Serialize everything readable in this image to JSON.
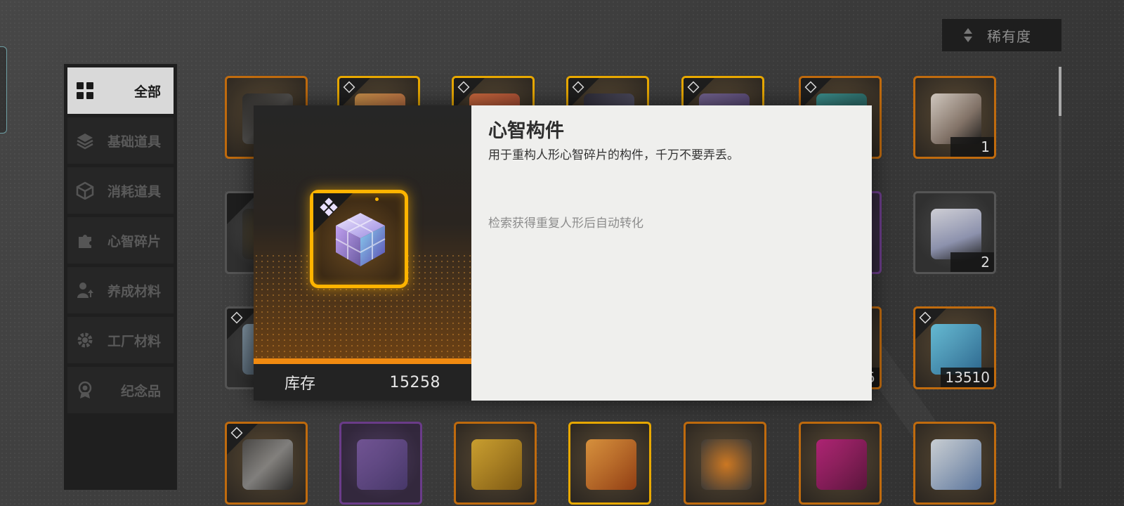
{
  "sort": {
    "label": "稀有度",
    "icon": "sort-icon"
  },
  "sidebar": {
    "items": [
      {
        "label": "全部",
        "icon": "grid-icon",
        "active": true
      },
      {
        "label": "基础道具",
        "icon": "layers-icon",
        "active": false
      },
      {
        "label": "消耗道具",
        "icon": "box-icon",
        "active": false
      },
      {
        "label": "心智碎片",
        "icon": "puzzle-icon",
        "active": false
      },
      {
        "label": "养成材料",
        "icon": "person-up-icon",
        "active": false
      },
      {
        "label": "工厂材料",
        "icon": "gear-icon",
        "active": false
      },
      {
        "label": "纪念品",
        "icon": "medal-icon",
        "active": false
      }
    ]
  },
  "grid": {
    "tiles": [
      {
        "rarity": "orange",
        "count": ""
      },
      {
        "rarity": "gold",
        "count": ""
      },
      {
        "rarity": "gold",
        "count": ""
      },
      {
        "rarity": "gold",
        "count": ""
      },
      {
        "rarity": "gold",
        "count": ""
      },
      {
        "rarity": "orange",
        "count": ""
      },
      {
        "rarity": "orange",
        "count": "1"
      },
      {
        "rarity": "grey",
        "count": ""
      },
      {
        "rarity": "purple",
        "count": ""
      },
      {
        "rarity": "grey",
        "count": "2"
      },
      {
        "rarity": "grey",
        "count": ""
      },
      {
        "rarity": "orange",
        "count": "5"
      },
      {
        "rarity": "orange",
        "count": "13510"
      },
      {
        "rarity": "orange",
        "count": ""
      },
      {
        "rarity": "purple",
        "count": ""
      },
      {
        "rarity": "orange",
        "count": ""
      },
      {
        "rarity": "gold",
        "count": ""
      },
      {
        "rarity": "orange",
        "count": ""
      },
      {
        "rarity": "orange",
        "count": ""
      },
      {
        "rarity": "orange",
        "count": ""
      }
    ]
  },
  "detail": {
    "name": "心智构件",
    "description": "用于重构人形心智碎片的构件，千万不要弄丢。",
    "note": "检索获得重复人形后自动转化",
    "stock_label": "库存",
    "stock_value": "15258",
    "rarity_color": "#ffb400"
  }
}
